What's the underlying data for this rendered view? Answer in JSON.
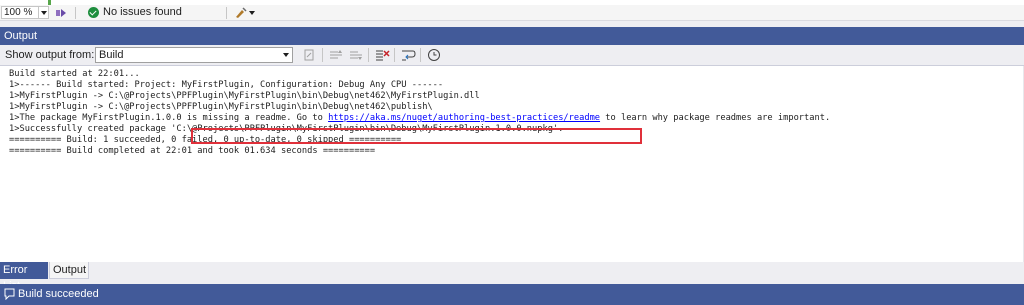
{
  "zoom_bar": {
    "zoom_value": "100 %",
    "issues_text": "No issues found"
  },
  "output_panel": {
    "title": "Output",
    "show_output_label": "Show output from:",
    "source_value": "Build",
    "lines": [
      "Build started at 22:01...",
      "1>------ Build started: Project: MyFirstPlugin, Configuration: Debug Any CPU ------",
      "1>MyFirstPlugin -> C:\\@Projects\\PPFPlugin\\MyFirstPlugin\\bin\\Debug\\net462\\MyFirstPlugin.dll",
      "1>MyFirstPlugin -> C:\\@Projects\\PPFPlugin\\MyFirstPlugin\\bin\\Debug\\net462\\publish\\"
    ],
    "readme_line": {
      "prefix": "1>The package MyFirstPlugin.1.0.0 is missing a readme. Go to ",
      "link": "https://aka.ms/nuget/authoring-best-practices/readme",
      "suffix": " to learn why package readmes are important."
    },
    "package_line": {
      "prefix": "1>Successfully created package ",
      "path": "'C:\\@Projects\\PPFPlugin\\MyFirstPlugin\\bin\\Debug\\MyFirstPlugin.1.0.0.nupkg'."
    },
    "summary_lines": [
      "========== Build: 1 succeeded, 0 failed, 0 up-to-date, 0 skipped ==========",
      "========== Build completed at 22:01 and took 01.634 seconds =========="
    ]
  },
  "tabs": {
    "error_list": "Error List",
    "output": "Output"
  },
  "status_bar": {
    "text": "Build succeeded"
  },
  "colors": {
    "accent": "#425a99",
    "success": "#1e8e3e",
    "highlight": "#e0303a",
    "link": "#0000ff"
  }
}
